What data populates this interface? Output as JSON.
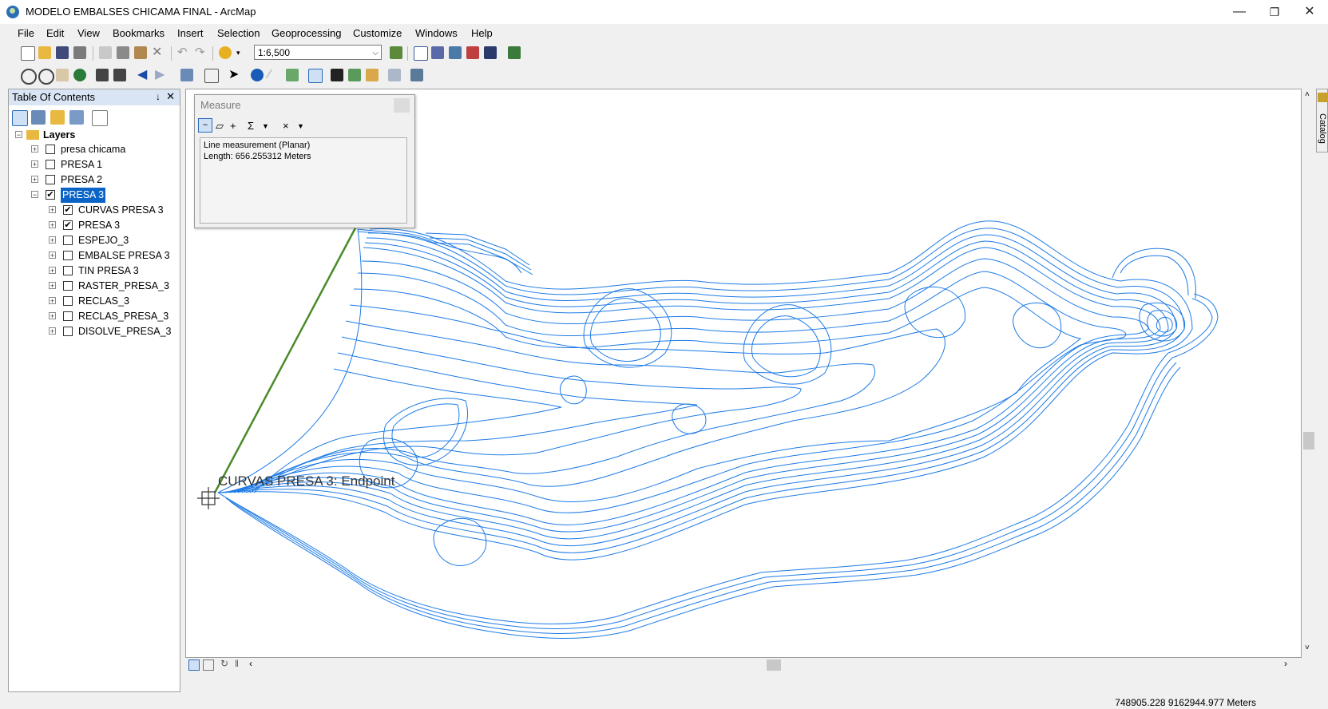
{
  "app": {
    "title": "MODELO EMBALSES CHICAMA FINAL - ArcMap",
    "minimize": "—",
    "restore": "❐",
    "close": "✕"
  },
  "menu": [
    "File",
    "Edit",
    "View",
    "Bookmarks",
    "Insert",
    "Selection",
    "Geoprocessing",
    "Customize",
    "Windows",
    "Help"
  ],
  "toolbar": {
    "scale": "1:6,500"
  },
  "toc": {
    "title": "Table Of Contents",
    "pin": "↓",
    "close": "✕",
    "root": "Layers",
    "groups": [
      {
        "label": "presa chicama",
        "checked": false,
        "expanded": false
      },
      {
        "label": "PRESA 1",
        "checked": false,
        "expanded": false
      },
      {
        "label": "PRESA 2",
        "checked": false,
        "expanded": false
      },
      {
        "label": "PRESA 3",
        "checked": true,
        "expanded": true,
        "selected": true
      }
    ],
    "sublayers": [
      {
        "label": "CURVAS PRESA 3",
        "checked": true
      },
      {
        "label": "PRESA 3",
        "checked": true
      },
      {
        "label": "ESPEJO_3",
        "checked": false
      },
      {
        "label": "EMBALSE PRESA 3",
        "checked": false
      },
      {
        "label": "TIN PRESA 3",
        "checked": false
      },
      {
        "label": "RASTER_PRESA_3",
        "checked": false
      },
      {
        "label": "RECLAS_3",
        "checked": false
      },
      {
        "label": "RECLAS_PRESA_3",
        "checked": false
      },
      {
        "label": "DISOLVE_PRESA_3",
        "checked": false
      }
    ]
  },
  "measure": {
    "title": "Measure",
    "line1": "Line measurement (Planar)",
    "line2": "Length: 656.255312 Meters"
  },
  "map": {
    "snap_label": "CURVAS PRESA 3: Endpoint",
    "contour_color": "#1e7be6",
    "measure_line_color": "#4a8a2a"
  },
  "catalog": {
    "label": "Catalog"
  },
  "status": {
    "coords": "748905.228  9162944.977 Meters"
  },
  "icons": [
    "new-doc-icon",
    "open-icon",
    "save-icon",
    "print-icon",
    "cut-icon",
    "copy-icon",
    "paste-icon",
    "delete-icon",
    "undo-icon",
    "redo-icon",
    "add-data-icon",
    "zoom-in-icon",
    "zoom-out-icon",
    "pan-icon",
    "globe-icon",
    "full-extent-icon",
    "back-icon",
    "forward-icon",
    "select-icon",
    "identify-icon",
    "find-icon",
    "measure-icon"
  ]
}
